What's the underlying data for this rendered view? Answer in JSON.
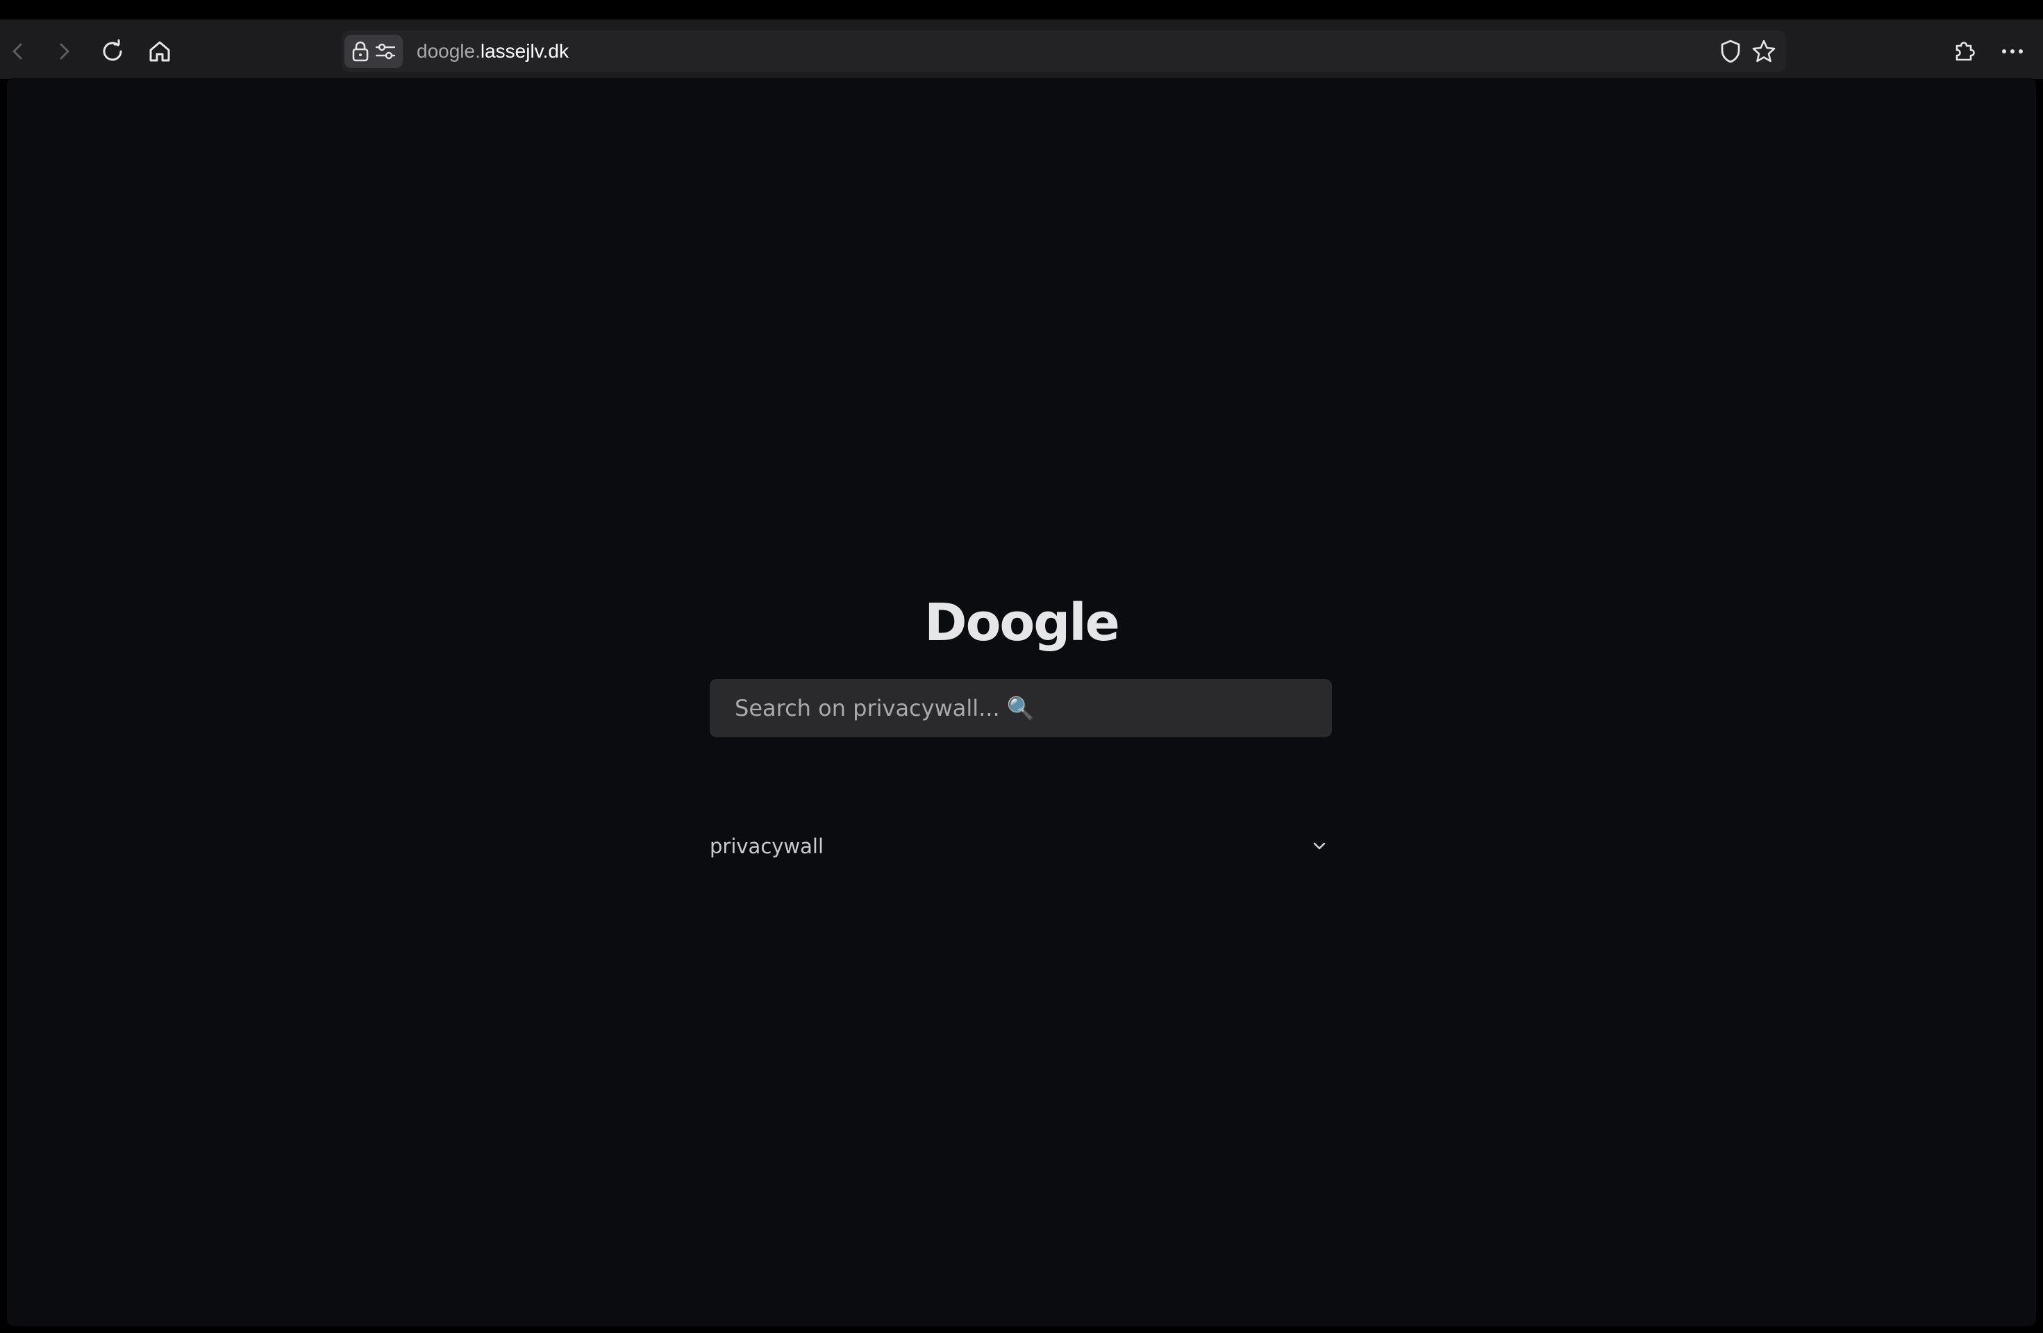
{
  "browser": {
    "url_subdomain": "doogle.",
    "url_domain": "lassejlv.dk",
    "icons": {
      "back": "chevron-left-icon",
      "forward": "chevron-right-icon",
      "reload": "reload-icon",
      "home": "home-icon",
      "lock": "lock-icon",
      "site_settings": "sliders-icon",
      "tracking_protection": "shield-icon",
      "bookmark": "star-icon",
      "extensions": "puzzle-icon",
      "menu": "more-icon"
    }
  },
  "page": {
    "logo": "Doogle",
    "search": {
      "placeholder": "Search on privacywall... 🔍",
      "value": ""
    },
    "engine": {
      "selected": "privacywall"
    }
  },
  "colors": {
    "page_background": "#0b0c0f",
    "toolbar_background": "#1c1c1e",
    "search_background": "#2a2a2d",
    "logo_text": "#e6e6e8"
  }
}
